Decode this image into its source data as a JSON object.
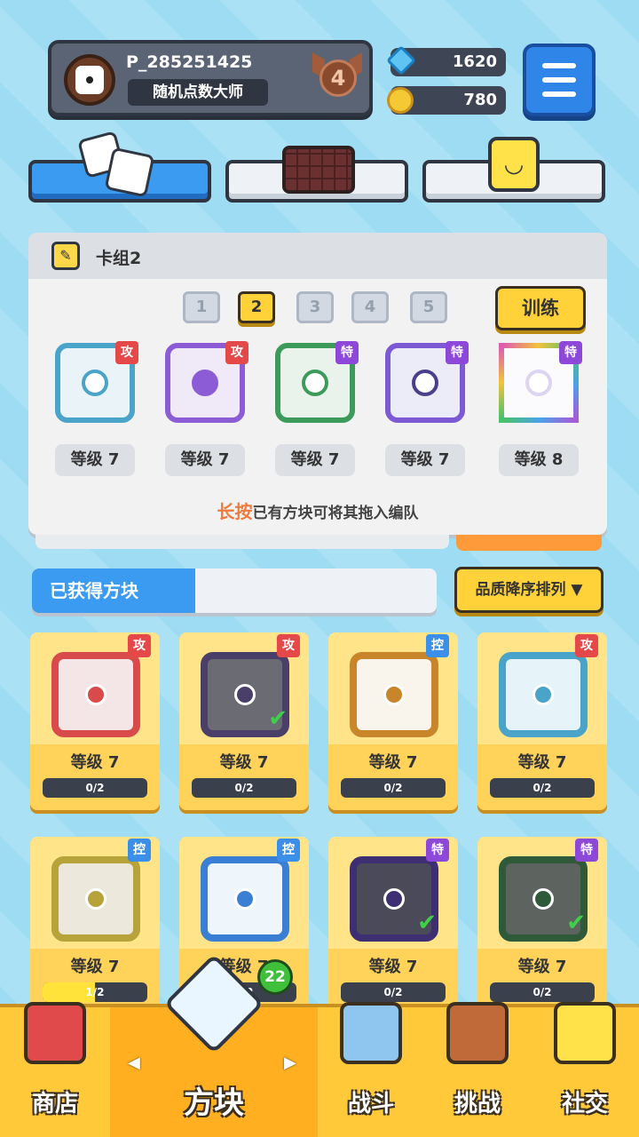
{
  "profile": {
    "name": "P_285251425",
    "title": "随机点数大师",
    "rank": "4"
  },
  "currency": {
    "gems": "1620",
    "coins": "780"
  },
  "deck": {
    "title": "卡组2",
    "tabs": [
      "1",
      "2",
      "3",
      "4",
      "5"
    ],
    "active_tab": "2",
    "train_label": "训练",
    "cards": [
      {
        "tag": "攻",
        "level": "等级 7",
        "color": "#4aa3c9"
      },
      {
        "tag": "攻",
        "level": "等级 7",
        "color": "#8b5cd6"
      },
      {
        "tag": "特",
        "level": "等级 7",
        "color": "#3c9a5a"
      },
      {
        "tag": "特",
        "level": "等级 7",
        "color": "#7b5ad4"
      },
      {
        "tag": "特",
        "level": "等级 8",
        "color": "#e05ab0"
      }
    ],
    "hint_emph": "长按",
    "hint_text": "已有方块可将其拖入编队"
  },
  "obtained": {
    "label": "已获得方块",
    "sort_label": "品质降序排列 ▼"
  },
  "grid": [
    {
      "tag": "攻",
      "level": "等级 7",
      "progress": "0/2",
      "fraction": 0,
      "color": "#d94a4a",
      "bg": "#f4e6e6",
      "checked": false
    },
    {
      "tag": "攻",
      "level": "等级 7",
      "progress": "0/2",
      "fraction": 0,
      "color": "#4a3f68",
      "bg": "#6b6b73",
      "checked": true
    },
    {
      "tag": "控",
      "level": "等级 7",
      "progress": "0/2",
      "fraction": 0,
      "color": "#c9852a",
      "bg": "#faf5ec",
      "checked": false
    },
    {
      "tag": "攻",
      "level": "等级 7",
      "progress": "0/2",
      "fraction": 0,
      "color": "#4aa3c9",
      "bg": "#e6f4fa",
      "checked": false
    },
    {
      "tag": "控",
      "level": "等级 7",
      "progress": "1/2",
      "fraction": 0.5,
      "color": "#b8a23a",
      "bg": "#ece8dc",
      "checked": false
    },
    {
      "tag": "控",
      "level": "等级 7",
      "progress": "0/2",
      "fraction": 0,
      "color": "#3b7fd4",
      "bg": "#eef6fc",
      "checked": false
    },
    {
      "tag": "特",
      "level": "等级 7",
      "progress": "0/2",
      "fraction": 0,
      "color": "#3e2f73",
      "bg": "#4a4a58",
      "checked": true
    },
    {
      "tag": "特",
      "level": "等级 7",
      "progress": "0/2",
      "fraction": 0,
      "color": "#2f5a3a",
      "bg": "#5d6460",
      "checked": true
    }
  ],
  "nav": {
    "items": [
      {
        "label": "商店",
        "icon": "shop-icon"
      },
      {
        "label": "方块",
        "icon": "dice-box-icon"
      },
      {
        "label": "战斗",
        "icon": "sword-shield-icon"
      },
      {
        "label": "挑战",
        "icon": "challenge-tower-icon"
      },
      {
        "label": "社交",
        "icon": "social-character-icon"
      }
    ],
    "active": "方块",
    "badge": "22"
  }
}
